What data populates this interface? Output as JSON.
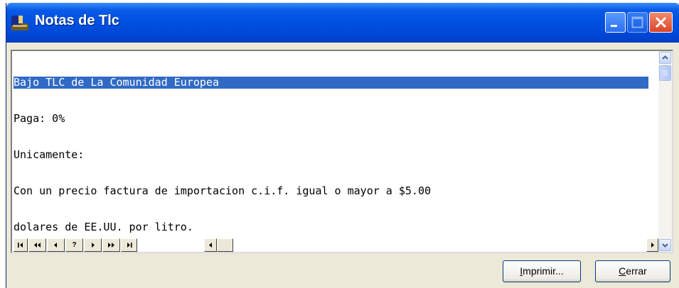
{
  "window": {
    "title": "Notas de Tlc"
  },
  "memo": {
    "lines": [
      "Bajo TLC de La Comunidad Europea",
      "Paga: 0%",
      "Unicamente:",
      "Con un precio factura de importacion c.i.f. igual o mayor a $5.00",
      "dolares de EE.UU. por litro."
    ],
    "selected_line": 0
  },
  "navigator": {
    "buttons": [
      {
        "name": "nav-first-button",
        "label": "I◂"
      },
      {
        "name": "nav-prior-page-button",
        "label": "◂◂"
      },
      {
        "name": "nav-prior-button",
        "label": "◂"
      },
      {
        "name": "nav-help-button",
        "label": "?"
      },
      {
        "name": "nav-next-button",
        "label": "▸"
      },
      {
        "name": "nav-next-page-button",
        "label": "▸▸"
      },
      {
        "name": "nav-last-button",
        "label": "▸I"
      }
    ]
  },
  "buttons": {
    "print": {
      "mnemonic": "I",
      "rest": "mprimir..."
    },
    "close": {
      "mnemonic": "C",
      "rest": "errar"
    }
  },
  "colors": {
    "titlebar": "#0050e0",
    "selection": "#316ac5",
    "dialog_bg": "#ece9d8"
  }
}
